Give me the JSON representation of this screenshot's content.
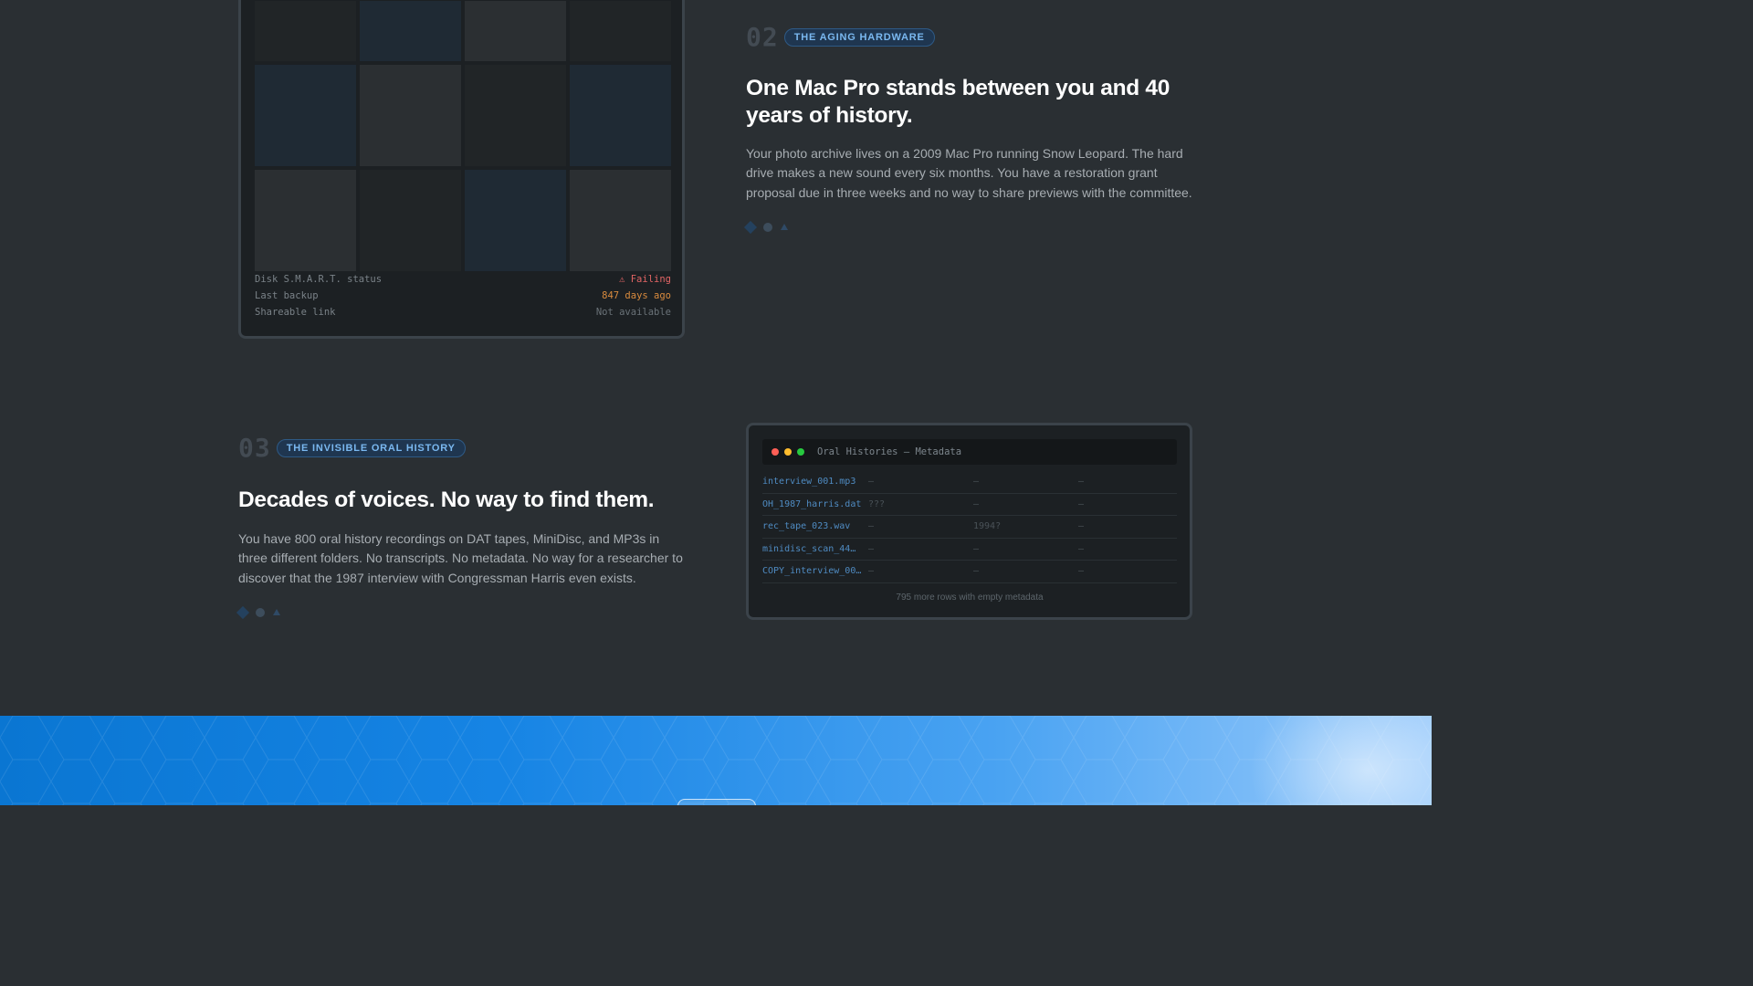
{
  "hardware_card": {
    "meta": [
      {
        "key": "Disk S.M.A.R.T. status",
        "value": "⚠ Failing",
        "color": "#e06464"
      },
      {
        "key": "Last backup",
        "value": "847 days ago",
        "color": "#d98b3e"
      },
      {
        "key": "Shareable link",
        "value": "Not available",
        "color": "#6a7278"
      }
    ]
  },
  "section_02": {
    "number": "02",
    "tag": "THE AGING HARDWARE",
    "title": "One Mac Pro stands between you and 40 years of history.",
    "body": "Your photo archive lives on a 2009 Mac Pro running Snow Leopard. The hard drive makes a new sound every six months. You have a restoration grant proposal due in three weeks and no way to share previews with the committee."
  },
  "section_03": {
    "number": "03",
    "tag": "THE INVISIBLE ORAL HISTORY",
    "title": "Decades of voices. No way to find them.",
    "body": "You have 800 oral history recordings on DAT tapes, MiniDisc, and MP3s in three different folders. No transcripts. No metadata. No way for a researcher to discover that the 1987 interview with Congressman Harris even exists."
  },
  "metadata_window": {
    "title": "Oral Histories — Metadata",
    "rows": [
      {
        "file": "interview_001.mp3",
        "c1": "—",
        "c2": "—",
        "c3": "—"
      },
      {
        "file": "OH_1987_harris.dat",
        "c1": "???",
        "c2": "—",
        "c3": "—"
      },
      {
        "file": "rec_tape_023.wav",
        "c1": "—",
        "c2": "1994?",
        "c3": "—"
      },
      {
        "file": "minidisc_scan_44…",
        "c1": "—",
        "c2": "—",
        "c3": "—"
      },
      {
        "file": "COPY_interview_00…",
        "c1": "—",
        "c2": "—",
        "c3": "—"
      }
    ],
    "footer": "795 more rows with empty metadata"
  },
  "colors": {
    "background": "#2a2f33",
    "accent": "#7ab8f0",
    "band_start": "#0a76d2",
    "band_end": "#9bcbfb"
  }
}
